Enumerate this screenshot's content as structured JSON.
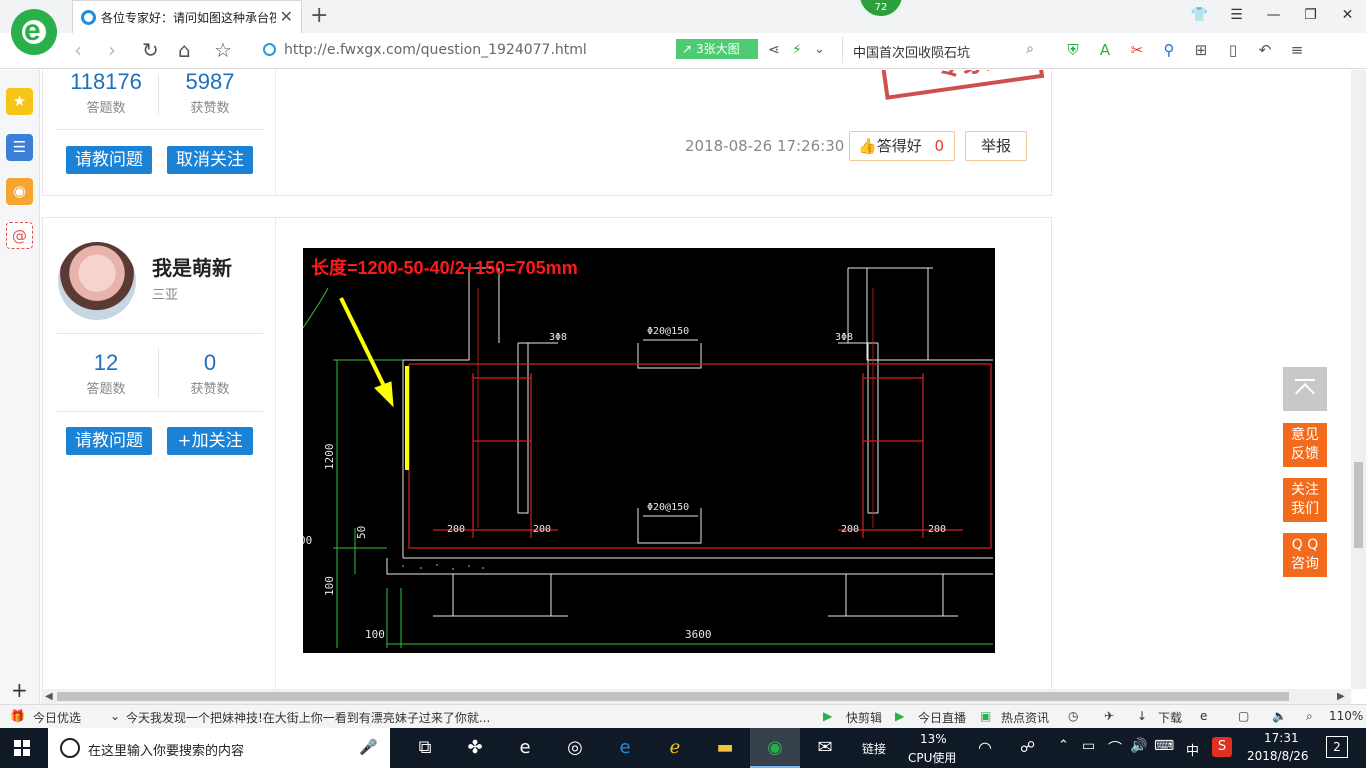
{
  "browser": {
    "tab_title": "各位专家好：请问如图这种承台筏",
    "close_glyph": "✕",
    "newtab_glyph": "+",
    "url": "http://e.fwxgx.com/question_1924077.html",
    "bigpic_label": "3张大图",
    "search_value": "中国首次回收陨石坑",
    "badge_count": "72"
  },
  "answer1": {
    "stats": [
      {
        "value": "118176",
        "label": "答题数"
      },
      {
        "value": "5987",
        "label": "获赞数"
      }
    ],
    "ask_button": "请教问题",
    "follow_button": "取消关注",
    "stamp_text": "专家",
    "date": "2018-08-26 17:26:30",
    "like_label": "答得好",
    "like_count": "0",
    "report_label": "举报"
  },
  "answer2": {
    "username": "我是萌新",
    "location": "三亚",
    "stats": [
      {
        "value": "12",
        "label": "答题数"
      },
      {
        "value": "0",
        "label": "获赞数"
      }
    ],
    "ask_button": "请教问题",
    "follow_button": "+加关注",
    "drawing": {
      "annotation": "长度=1200-50-40/2+150=705mm",
      "rebar_labels": [
        "3Φ8",
        "Φ20@150",
        "3Φ8",
        "Φ20@150"
      ],
      "dim_200": [
        "200",
        "200",
        "200",
        "200"
      ],
      "dim_1200": "1200",
      "dim_50": "50",
      "dim_100_v": "100",
      "dim_100_h": "100",
      "dim_3600": "3600",
      "dim_left_cut": "00"
    }
  },
  "float_buttons": {
    "feedback": "意见\n反馈",
    "follow_us": "关注\n我们",
    "qq": "Q Q\n咨询"
  },
  "statusbar": {
    "today_pick": "今日优选",
    "news": "今天我发现一个把妹神技!在大街上你一看到有漂亮妹子过来了你就...",
    "quick_clip": "快剪辑",
    "live": "今日直播",
    "hot_news": "热点资讯",
    "download": "下载",
    "zoom": "110%"
  },
  "taskbar": {
    "search_placeholder": "在这里输入你要搜索的内容",
    "link_label": "链接",
    "cpu_percent": "13%",
    "cpu_label": "CPU使用",
    "ime": "中",
    "time": "17:31",
    "date": "2018/8/26",
    "notif_count": "2"
  },
  "colors": {
    "accent_blue": "#1b82d6",
    "float_orange": "#f26a1b",
    "cad_red": "#e82020",
    "cad_arrow": "#ffff00"
  }
}
